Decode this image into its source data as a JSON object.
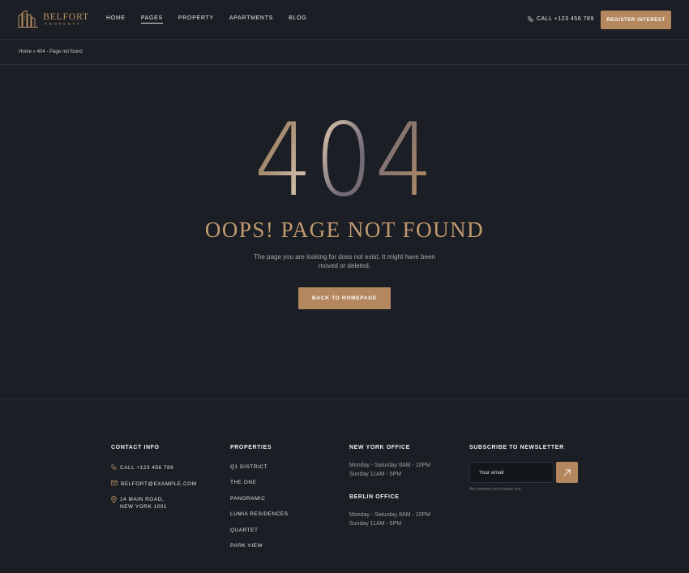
{
  "brand": {
    "name": "BELFORT",
    "tagline": "PROPERTY",
    "accent": "#b4875e"
  },
  "nav": {
    "items": [
      {
        "label": "HOME",
        "active": false
      },
      {
        "label": "PAGES",
        "active": true
      },
      {
        "label": "PROPERTY",
        "active": false
      },
      {
        "label": "APARTMENTS",
        "active": false
      },
      {
        "label": "BLOG",
        "active": false
      }
    ],
    "phone": "CALL +123 456 789",
    "cta": "REGISTER INTEREST"
  },
  "breadcrumb": "Home » 404 - Page not found",
  "error": {
    "code": "404",
    "title": "OOPS! PAGE NOT FOUND",
    "message": "The page you are looking for does not exist. It might have been moved or deleted.",
    "button": "BACK TO HOMEPAGE"
  },
  "footer": {
    "contact": {
      "title": "CONTACT INFO",
      "phone": "CALL +123 456 789",
      "email": "BELFORT@EXAMPLE.COM",
      "address_line1": "14 MAIN ROAD,",
      "address_line2": "NEW YORK 1001"
    },
    "properties": {
      "title": "PROPERTIES",
      "items": [
        "Q1 DISTRICT",
        "THE ONE",
        "PANORAMIC",
        "LUMIA RESIDENCES",
        "QUARTET",
        "PARK VIEW"
      ]
    },
    "ny_office": {
      "title": "NEW YORK OFFICE",
      "line1": "Monday - Saturday 8AM - 10PM",
      "line2": "Sunday 11AM - 5PM"
    },
    "berlin_office": {
      "title": "BERLIN OFFICE",
      "line1": "Monday - Saturday 8AM - 10PM",
      "line2": "Sunday 11AM - 5PM"
    },
    "newsletter": {
      "title": "SUBSCRIBE TO NEWSLETTER",
      "placeholder": "Your email",
      "note": "We promise not to spam you"
    }
  }
}
